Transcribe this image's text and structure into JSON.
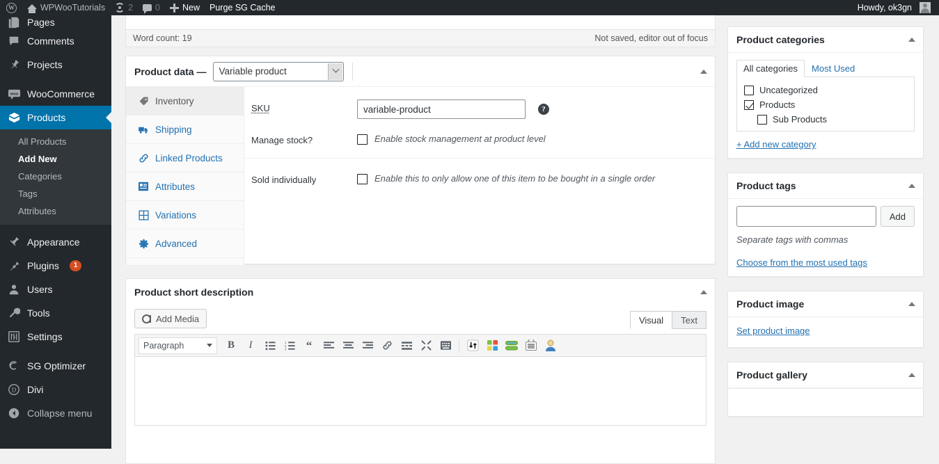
{
  "adminbar": {
    "site_name": "WPWooTutorials",
    "revisions_count": "2",
    "comments_count": "0",
    "new_label": "New",
    "purge_label": "Purge SG Cache",
    "howdy": "Howdy, ok3gn"
  },
  "sidebar": {
    "items": [
      {
        "label": "Pages",
        "icon": "pages-icon"
      },
      {
        "label": "Comments",
        "icon": "comments-icon"
      },
      {
        "label": "Projects",
        "icon": "pin-icon"
      },
      {
        "label": "WooCommerce",
        "icon": "woocommerce-icon"
      },
      {
        "label": "Products",
        "icon": "products-icon",
        "current": true
      },
      {
        "label": "Appearance",
        "icon": "appearance-icon"
      },
      {
        "label": "Plugins",
        "icon": "plugins-icon",
        "badge": "1"
      },
      {
        "label": "Users",
        "icon": "users-icon"
      },
      {
        "label": "Tools",
        "icon": "tools-icon"
      },
      {
        "label": "Settings",
        "icon": "settings-icon"
      },
      {
        "label": "SG Optimizer",
        "icon": "sg-optimizer-icon"
      },
      {
        "label": "Divi",
        "icon": "divi-icon"
      },
      {
        "label": "Collapse menu",
        "icon": "collapse-icon"
      }
    ],
    "submenu": [
      {
        "label": "All Products"
      },
      {
        "label": "Add New",
        "current": true
      },
      {
        "label": "Categories"
      },
      {
        "label": "Tags"
      },
      {
        "label": "Attributes"
      }
    ]
  },
  "editor_status": {
    "word_count": "Word count: 19",
    "save_status": "Not saved, editor out of focus"
  },
  "product_data": {
    "title": "Product data —",
    "type_selected": "Variable product",
    "tabs": [
      {
        "label": "Inventory",
        "icon": "tag-icon",
        "active": true
      },
      {
        "label": "Shipping",
        "icon": "truck-icon",
        "active": false
      },
      {
        "label": "Linked Products",
        "icon": "link-icon",
        "active": false
      },
      {
        "label": "Attributes",
        "icon": "attributes-icon",
        "active": false
      },
      {
        "label": "Variations",
        "icon": "grid-icon",
        "active": false
      },
      {
        "label": "Advanced",
        "icon": "gear-icon",
        "active": false
      }
    ],
    "sku_label": "SKU",
    "sku_value": "variable-product",
    "help_icon": "help-icon",
    "manage_stock_label": "Manage stock?",
    "manage_stock_desc": "Enable stock management at product level",
    "manage_stock_checked": false,
    "sold_individually_label": "Sold individually",
    "sold_individually_desc": "Enable this to only allow one of this item to be bought in a single order",
    "sold_individually_checked": false
  },
  "short_description": {
    "title": "Product short description",
    "add_media_label": "Add Media",
    "tab_visual": "Visual",
    "tab_text": "Text",
    "format_selected": "Paragraph",
    "toolbar_icons": [
      "bold-icon",
      "italic-icon",
      "bulleted-list-icon",
      "numbered-list-icon",
      "blockquote-icon",
      "align-left-icon",
      "align-center-icon",
      "align-right-icon",
      "link-icon",
      "read-more-icon",
      "fullscreen-icon",
      "toolbar-toggle-icon",
      "sort-arrows-icon",
      "color-grid-icon",
      "bars-icon",
      "lined-box-icon",
      "person-icon"
    ]
  },
  "product_categories": {
    "title": "Product categories",
    "tab_all": "All categories",
    "tab_most_used": "Most Used",
    "items": [
      {
        "label": "Uncategorized",
        "checked": false,
        "child": false
      },
      {
        "label": "Products",
        "checked": true,
        "child": false
      },
      {
        "label": "Sub Products",
        "checked": false,
        "child": true
      }
    ],
    "add_new_link": "+ Add new category"
  },
  "product_tags": {
    "title": "Product tags",
    "input_value": "",
    "add_button": "Add",
    "hint": "Separate tags with commas",
    "most_used_link": "Choose from the most used tags"
  },
  "product_image": {
    "title": "Product image",
    "set_link": "Set product image"
  },
  "product_gallery": {
    "title": "Product gallery"
  },
  "colors": {
    "admin_bar": "#23282d",
    "menu_current": "#0073aa",
    "link": "#2271b1",
    "badge": "#d54e21",
    "page_bg": "#f1f1f1"
  }
}
